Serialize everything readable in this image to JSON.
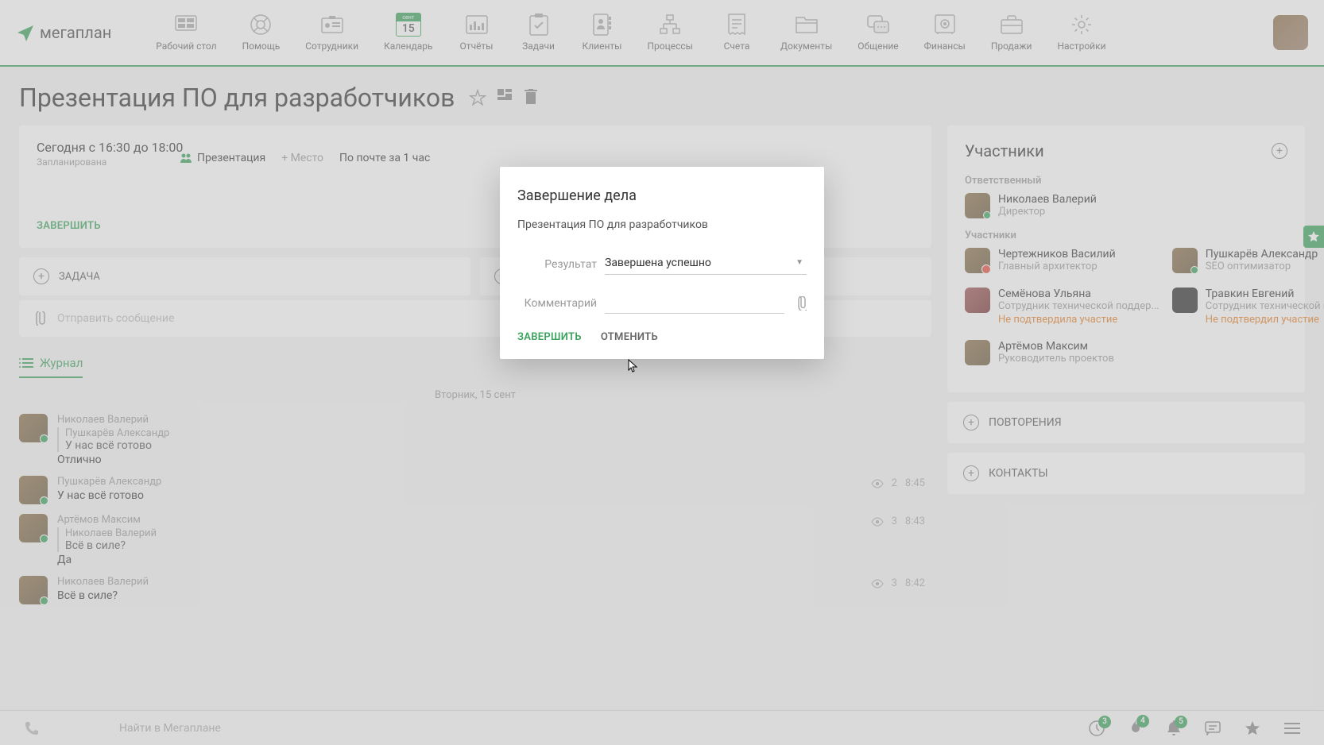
{
  "logo_text": "мегаплан",
  "nav": {
    "items": [
      {
        "label": "Рабочий стол"
      },
      {
        "label": "Помощь"
      },
      {
        "label": "Сотрудники"
      },
      {
        "label": "Календарь"
      },
      {
        "label": "Отчёты"
      },
      {
        "label": "Задачи"
      },
      {
        "label": "Клиенты"
      },
      {
        "label": "Процессы"
      },
      {
        "label": "Счета"
      },
      {
        "label": "Документы"
      },
      {
        "label": "Общение"
      },
      {
        "label": "Финансы"
      },
      {
        "label": "Продажи"
      },
      {
        "label": "Настройки"
      }
    ],
    "cal_month": "сент",
    "cal_day": "15"
  },
  "page": {
    "title": "Презентация ПО для разработчиков"
  },
  "event": {
    "time": "Сегодня с 16:30 до 18:00",
    "status": "Запланирована",
    "tag": "Презентация",
    "place": "+ Место",
    "notify": "По почте за 1 час",
    "complete": "ЗАВЕРШИТЬ"
  },
  "taskbar": {
    "task": "ЗАДАЧА"
  },
  "msg": {
    "placeholder": "Отправить сообщение"
  },
  "journal": {
    "tab": "Журнал",
    "date": "Вторник, 15 сент",
    "entries": [
      {
        "author": "Николаев Валерий",
        "reply_author": "Пушкарёв Александр",
        "reply_text": "У нас всё готово",
        "text": "Отлично"
      },
      {
        "author": "Пушкарёв Александр",
        "text": "У нас всё готово",
        "views": "2",
        "time": "8:45"
      },
      {
        "author": "Артёмов Максим",
        "reply_author": "Николаев Валерий",
        "reply_text": "Всё в силе?",
        "text": "Да",
        "views": "3",
        "time": "8:43"
      },
      {
        "author": "Николаев Валерий",
        "text": "Всё в силе?",
        "views": "3",
        "time": "8:42"
      }
    ]
  },
  "sidebar": {
    "participants_title": "Участники",
    "responsible_label": "Ответственный",
    "participants_label": "Участники",
    "responsible": {
      "name": "Николаев Валерий",
      "role": "Директор"
    },
    "people": [
      {
        "name": "Чертежников Василий",
        "role": "Главный архитектор"
      },
      {
        "name": "Пушкарёв Александр",
        "role": "SEO оптимизатор"
      },
      {
        "name": "Семёнова Ульяна",
        "role": "Сотрудник технической поддер...",
        "warn": "Не подтвердила участие"
      },
      {
        "name": "Травкин Евгений",
        "role": "Сотрудник технической поддер...",
        "warn": "Не подтвердил участие"
      },
      {
        "name": "Артёмов Максим",
        "role": "Руководитель проектов"
      }
    ],
    "repeats": "ПОВТОРЕНИЯ",
    "contacts": "КОНТАКТЫ"
  },
  "modal": {
    "title": "Завершение дела",
    "subtitle": "Презентация ПО для разработчиков",
    "result_label": "Результат",
    "result_value": "Завершена успешно",
    "comment_label": "Комментарий",
    "complete": "ЗАВЕРШИТЬ",
    "cancel": "ОТМЕНИТЬ"
  },
  "bottombar": {
    "search": "Найти в Мегаплане",
    "badge1": "3",
    "badge2": "4",
    "badge3": "5"
  }
}
